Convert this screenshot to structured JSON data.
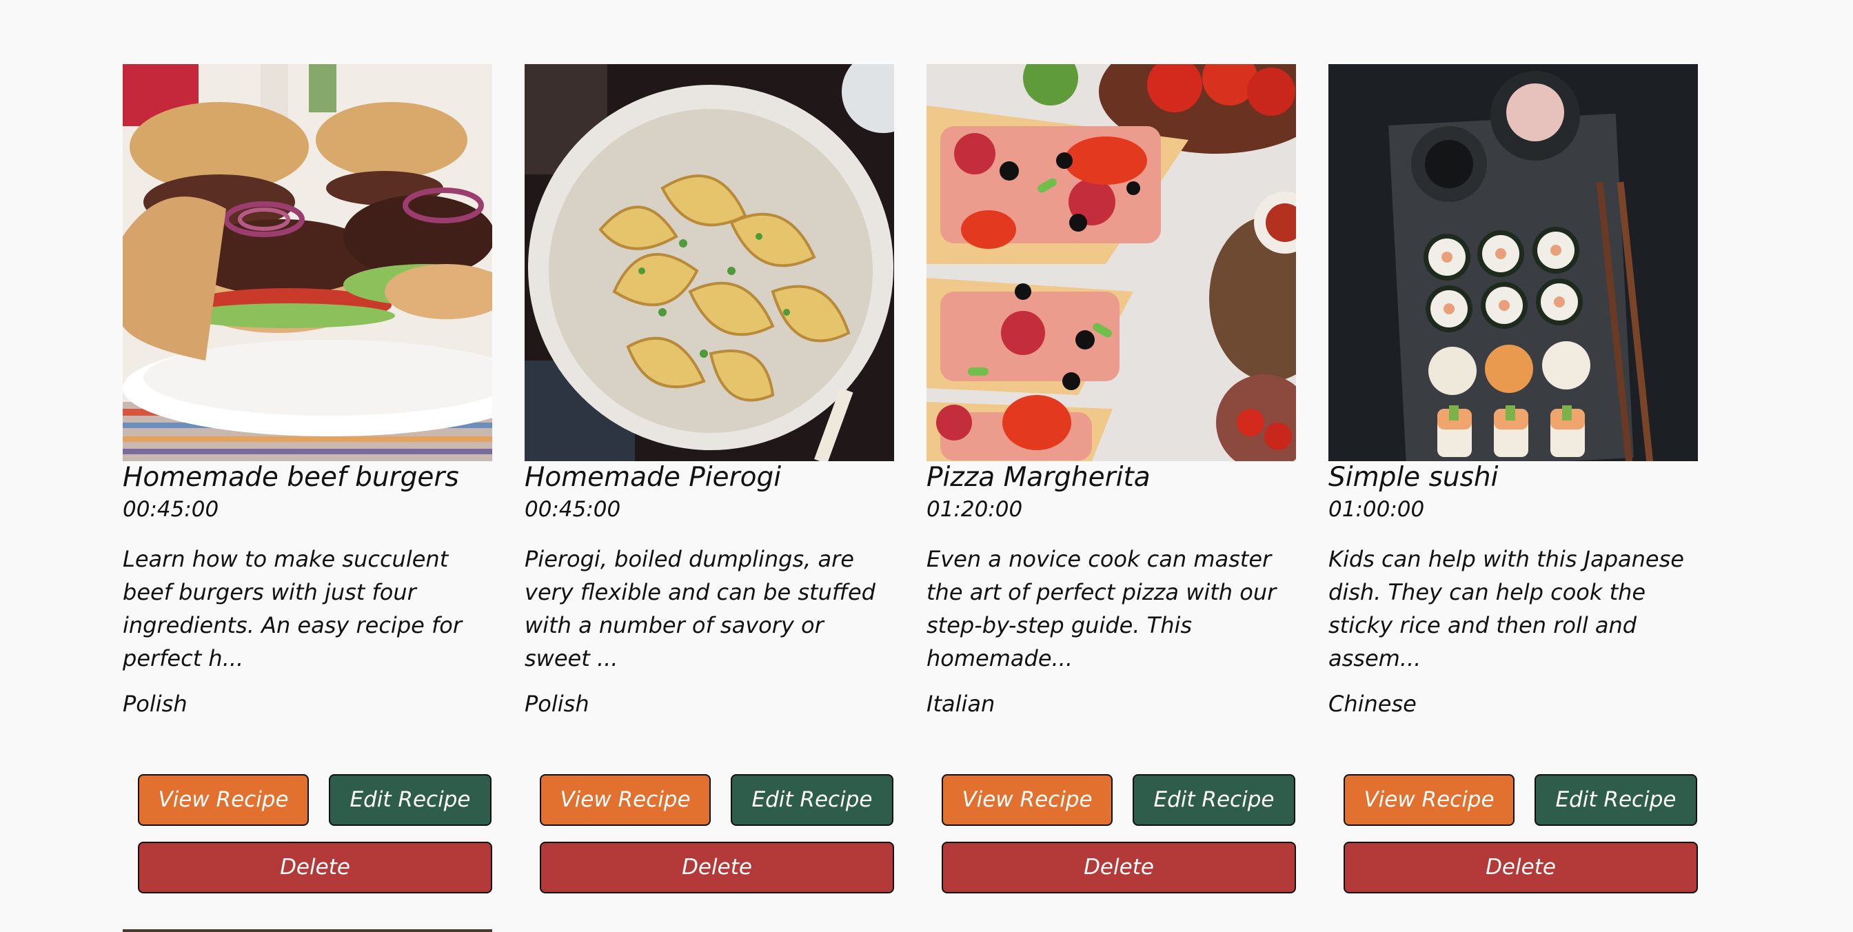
{
  "recipes": [
    {
      "title": "Homemade beef burgers",
      "time": "00:45:00",
      "description": "Learn how to make succulent beef burgers with just four ingredients. An easy recipe for perfect h...",
      "cuisine": "Polish",
      "image": "beef-burgers-photo"
    },
    {
      "title": "Homemade Pierogi",
      "time": "00:45:00",
      "description": "Pierogi, boiled dumplings, are very flexible and can be stuffed with a number of savory or sweet ...",
      "cuisine": "Polish",
      "image": "pierogi-photo"
    },
    {
      "title": "Pizza Margherita",
      "time": "01:20:00",
      "description": "Even a novice cook can master the art of perfect pizza with our step-by-step guide. This homemade...",
      "cuisine": "Italian",
      "image": "pizza-photo"
    },
    {
      "title": "Simple sushi",
      "time": "01:00:00",
      "description": "Kids can help with this Japanese dish. They can help cook the sticky rice and then roll and assem...",
      "cuisine": "Chinese",
      "image": "sushi-photo"
    }
  ],
  "buttons": {
    "view": "View Recipe",
    "edit": "Edit Recipe",
    "delete": "Delete"
  },
  "colors": {
    "background": "#f9f9f9",
    "view_button": "#e2702e",
    "edit_button": "#2f5d4b",
    "delete_button": "#b33a38"
  }
}
